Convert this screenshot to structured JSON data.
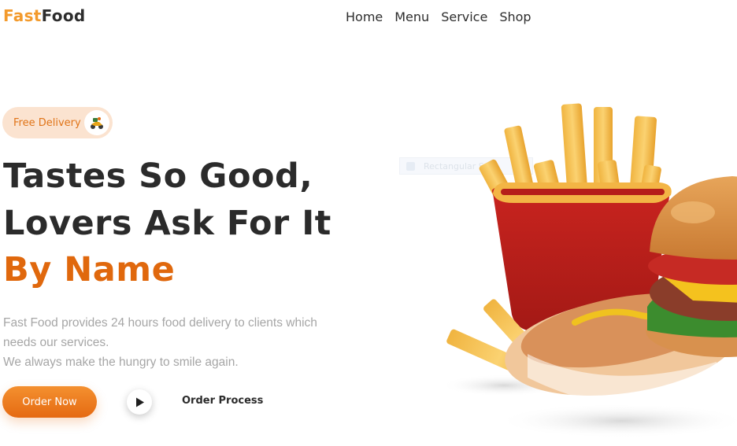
{
  "brand": {
    "part1": "Fast",
    "part2": "Food"
  },
  "nav": {
    "items": [
      "Home",
      "Menu",
      "Service",
      "Shop"
    ]
  },
  "badge": {
    "label": "Free Delivery",
    "icon": "scooter-icon"
  },
  "hero": {
    "line1": "Tastes So Good,",
    "line2": "Lovers Ask For It",
    "line3": "By Name"
  },
  "description": {
    "line1": "Fast Food provides 24 hours food delivery to clients which",
    "line2": "needs our services.",
    "line3": "We always make the hungry to smile again."
  },
  "actions": {
    "order_now": "Order Now",
    "order_process": "Order Process",
    "play_icon": "play-icon"
  },
  "overlay": {
    "label": "Rectangular Snip"
  },
  "colors": {
    "accent": "#e56a12",
    "accent_light": "#f39a2c",
    "badge_bg": "#fbe3d0",
    "text_dark": "#2b2b2b",
    "text_muted": "#a6a6a6"
  }
}
